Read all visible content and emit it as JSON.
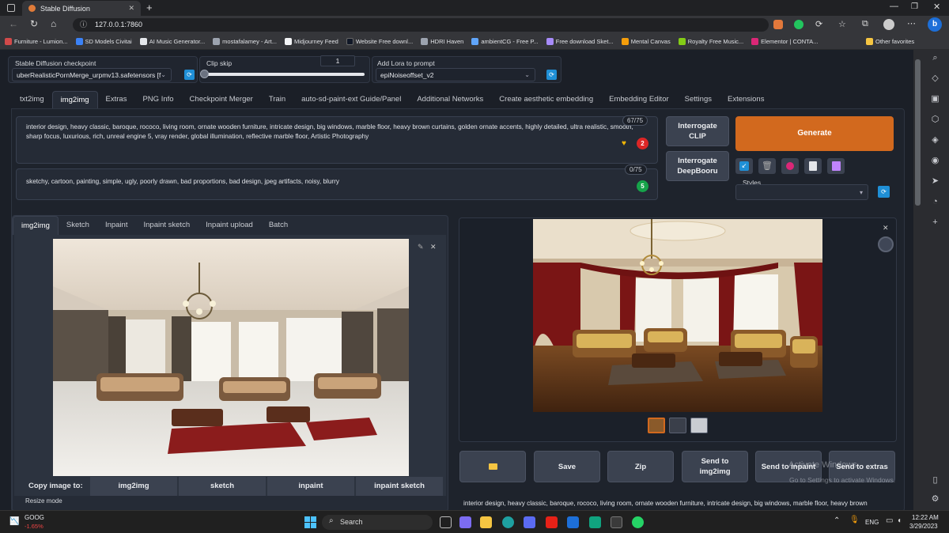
{
  "browser": {
    "tab_title": "Stable Diffusion",
    "url": "127.0.0.1:7860",
    "favorites": [
      {
        "label": "Furniture - Lumion...",
        "color": "#d24a4a"
      },
      {
        "label": "SD Models Civitai",
        "color": "#3b82f6"
      },
      {
        "label": "AI Music Generator...",
        "color": "#e5e7eb"
      },
      {
        "label": "mostafalamey - Art...",
        "color": "#9ca3af"
      },
      {
        "label": "Midjourney Feed",
        "color": "#f3f4f6"
      },
      {
        "label": "Website Free downl...",
        "color": "#111827"
      },
      {
        "label": "HDRI Haven",
        "color": "#9ca3af"
      },
      {
        "label": "ambientCG - Free P...",
        "color": "#60a5fa"
      },
      {
        "label": "Free download Sket...",
        "color": "#a78bfa"
      },
      {
        "label": "Mental Canvas",
        "color": "#f59e0b"
      },
      {
        "label": "Royalty Free Music...",
        "color": "#84cc16"
      },
      {
        "label": "Elementor | CONTA...",
        "color": "#db2777"
      }
    ],
    "other_favorites": "Other favorites"
  },
  "top_controls": {
    "checkpoint_label": "Stable Diffusion checkpoint",
    "checkpoint_value": "uberRealisticPornMerge_urpmv13.safetensors [f",
    "clip_skip_label": "Clip skip",
    "clip_skip_value": "1",
    "lora_label": "Add Lora to prompt",
    "lora_value": "epiNoiseoffset_v2"
  },
  "main_tabs": [
    "txt2img",
    "img2img",
    "Extras",
    "PNG Info",
    "Checkpoint Merger",
    "Train",
    "auto-sd-paint-ext Guide/Panel",
    "Additional Networks",
    "Create aesthetic embedding",
    "Embedding Editor",
    "Settings",
    "Extensions"
  ],
  "prompt": {
    "positive_line1": "interior design, heavy classic, baroque, rococo, living room, ornate wooden furniture, intricate design, big windows, marble floor, heavy brown curtains, golden ornate accents, highly detailed, ultra realistic, smooth,",
    "positive_line2": "sharp focus, luxurious, rich, unreal engine 5, vray render, global illumination, reflective marble floor, Artistic Photography",
    "positive_count": "67/75",
    "negative": "sketchy, cartoon, painting, simple, ugly, poorly drawn, bad proportions, bad design, jpeg artifacts, noisy, blurry",
    "negative_count": "0/75",
    "badge_pos": "2",
    "badge_neg": "5"
  },
  "actions": {
    "interrogate_clip": "Interrogate\nCLIP",
    "interrogate_deepbooru": "Interrogate\nDeepBooru",
    "generate": "Generate",
    "styles_label": "Styles"
  },
  "sub_tabs": [
    "img2img",
    "Sketch",
    "Inpaint",
    "Inpaint sketch",
    "Inpaint upload",
    "Batch"
  ],
  "copy_image": {
    "label": "Copy image to:",
    "buttons": [
      "img2img",
      "sketch",
      "inpaint",
      "inpaint sketch"
    ]
  },
  "resize_mode_label": "Resize mode",
  "output": {
    "buttons": [
      "Save",
      "Zip",
      "Send to\nimg2img",
      "Send to inpaint",
      "Send to extras"
    ],
    "caption": "interior design, heavy classic, baroque, rococo, living room, ornate wooden furniture, intricate design, big windows, marble floor, heavy brown",
    "watermark_line1": "Activate Windows",
    "watermark_line2": "Go to Settings to activate Windows."
  },
  "taskbar": {
    "ticker": "GOOG",
    "ticker_change": "-1.65%",
    "search": "Search",
    "lang": "ENG",
    "time": "12:22 AM",
    "date": "3/29/2023"
  },
  "colors": {
    "generate": "#d2691e",
    "accent_blue": "#1f8fd6",
    "panel": "#252b36"
  }
}
